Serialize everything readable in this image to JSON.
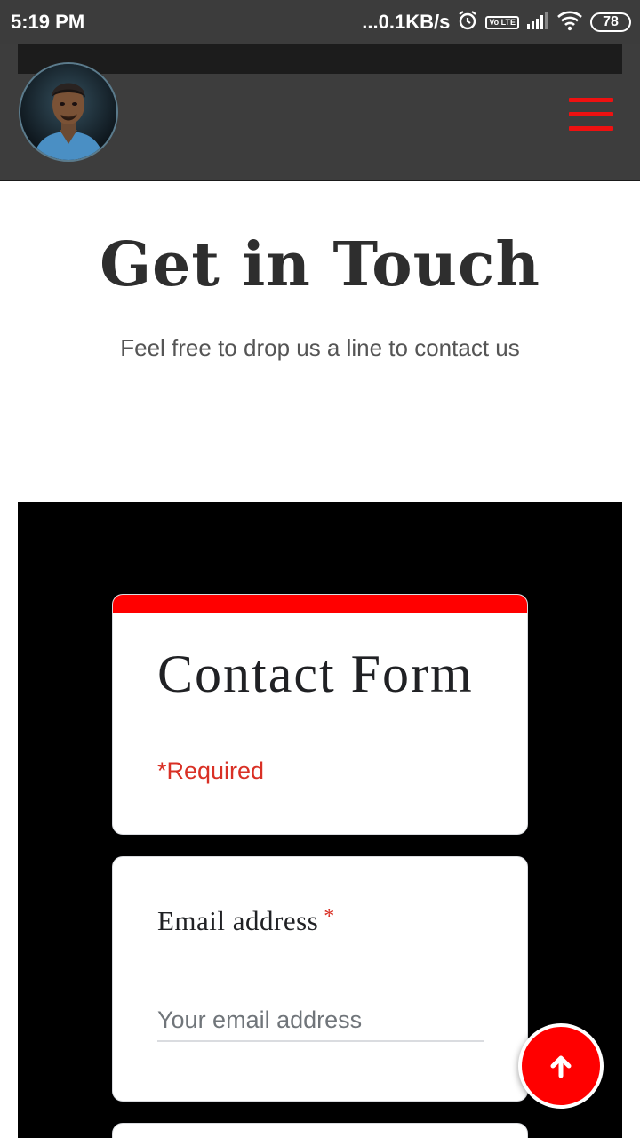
{
  "status_bar": {
    "time": "5:19 PM",
    "net_speed": "...0.1KB/s",
    "volte": "Vo LTE",
    "battery": "78",
    "icons": [
      "alarm-icon",
      "volte-icon",
      "signal-icon",
      "wifi-icon",
      "battery-icon"
    ]
  },
  "header": {
    "avatar_alt": "profile photo",
    "menu_icon": "hamburger-menu-icon"
  },
  "hero": {
    "title": "Get in Touch",
    "subtitle": "Feel free to drop us a line to contact us"
  },
  "form": {
    "title": "Contact Form",
    "required_note": "*Required",
    "email": {
      "label": "Email address",
      "required_mark": "*",
      "placeholder": "Your email address",
      "value": ""
    }
  },
  "back_to_top": {
    "icon": "arrow-up-icon"
  },
  "colors": {
    "accent": "#ff0000",
    "header_bg": "#3d3d3d",
    "section_bg": "#000000",
    "required": "#d93025"
  }
}
